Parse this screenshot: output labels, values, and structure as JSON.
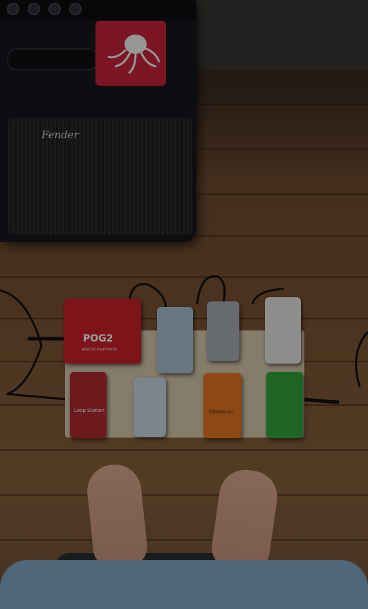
{
  "scene": {
    "amp_logo": "Fender",
    "pedals": {
      "pog_label": "POG2",
      "pog_brand": "electro-harmonix",
      "loop_label": "Loop Station",
      "distortion_label": "Distortion"
    }
  },
  "colors": {
    "floor": "#7b5434",
    "amp": "#16181c",
    "sticker": "#c8243a",
    "pog": "#c8212b",
    "distortion": "#e57420",
    "ibanez": "#32a33a",
    "shirt": "#7fa6c6"
  }
}
